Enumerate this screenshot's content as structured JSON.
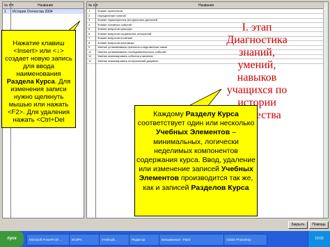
{
  "left_grid": {
    "headers": [
      "№ п/п",
      "Название"
    ],
    "rows": [
      {
        "num": "1",
        "name": "История Отечества 2004"
      }
    ]
  },
  "right_grid": {
    "headers": [
      "№ п/п",
      "Название"
    ],
    "rows": [
      {
        "num": "1",
        "name": "Знание хронологии"
      },
      {
        "num": "2",
        "name": "Определение понятий"
      },
      {
        "num": "3",
        "name": "Знание характеристик исторических деятелей"
      },
      {
        "num": "4",
        "name": "Знание основных событий"
      },
      {
        "num": "5",
        "name": "Знание вопросов культуры"
      },
      {
        "num": "6",
        "name": "Знание вопросов социальных отношений"
      },
      {
        "num": "7",
        "name": "Знание вопросов политики"
      },
      {
        "num": "8",
        "name": "Знание вопросов экономики"
      },
      {
        "num": "9",
        "name": "Умение устанавливать причинно-следственные связи"
      },
      {
        "num": "10",
        "name": "Умение устанавливать последовательность событий"
      },
      {
        "num": "11",
        "name": "Умение анализировать события и явления"
      },
      {
        "num": "12",
        "name": "Умение анализировать исторический документ"
      }
    ]
  },
  "red_title": "I. этап Диагностика знаний, умений, навыков учащихся по истории Отечества",
  "callout_left": {
    "line1": "Нажатие клавиш <Insert> или <",
    "arrow_glyph": "↓",
    "line2": "> создает новую запись для ввода наименования",
    "bold": "Раздела Курса",
    "line3": ". Для изменения записи нужно щелкнуть мышью или нажать <F2>. Для удаления нажать <Ctrl+Del"
  },
  "callout_big": {
    "t1": "Каждому ",
    "b1": "Разделу Курса",
    "t2": " соответствует один или несколько ",
    "b2": "Учебных Элементов",
    "t3": " – минимальных, логически неделимых компонентов содержания курса. Ввод, удаление или изменение записей ",
    "b3": "Учебных Элементов",
    "t4": " производится так же, как и записей ",
    "b4": "Разделов Курса"
  },
  "buttons": {
    "close": "Закрыть",
    "help": "Помощь"
  },
  "taskbar": {
    "start": "пуск",
    "tasks": [
      "Microsoft PowerPoint ...",
      "ИСКРА",
      "Учебный...",
      "Редактор",
      "Безымянный - Paint",
      "Adobe Photoshop"
    ],
    "clock": "10:02"
  }
}
